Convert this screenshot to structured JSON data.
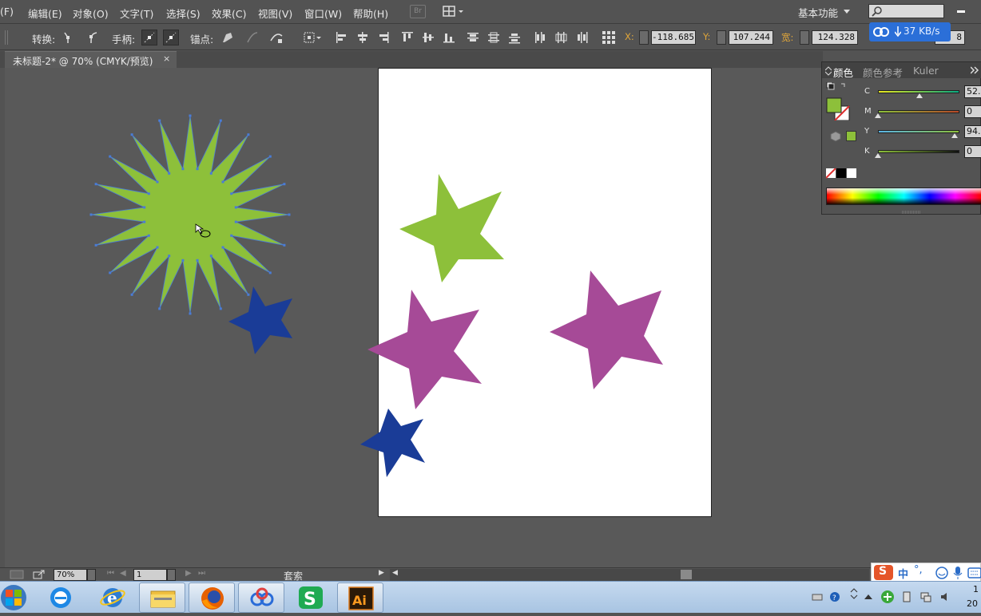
{
  "menubar": {
    "items": [
      "(F)",
      "编辑(E)",
      "对象(O)",
      "文字(T)",
      "选择(S)",
      "效果(C)",
      "视图(V)",
      "窗口(W)",
      "帮助(H)"
    ],
    "bridge_label": "Br",
    "workspace_label": "基本功能"
  },
  "controlbar": {
    "convert_label": "转换:",
    "handles_label": "手柄:",
    "anchors_label": "锚点:",
    "x_label": "X:",
    "x_value": "-118.685",
    "y_label": "Y:",
    "y_value": "107.244",
    "w_label": "宽:",
    "w_value": "124.328",
    "h_value": "8"
  },
  "speed_badge": {
    "text": "37 KB/s"
  },
  "document": {
    "tab_title": "未标题-2* @ 70% (CMYK/预览)",
    "close_glyph": "×"
  },
  "color_panel": {
    "tabs": [
      "颜色",
      "颜色参考",
      "Kuler"
    ],
    "channels": [
      {
        "label": "C",
        "value": "52."
      },
      {
        "label": "M",
        "value": "0"
      },
      {
        "label": "Y",
        "value": "94."
      },
      {
        "label": "K",
        "value": "0"
      }
    ]
  },
  "statusbar": {
    "zoom": "70%",
    "artboard": "1",
    "tool_name": "套索"
  },
  "taskbar": {
    "clock_top": "1",
    "clock_bottom": "20",
    "ime_text": "中"
  },
  "colors": {
    "green": "#8dc03a",
    "purple": "#a64a97",
    "blue": "#1a3c97",
    "panel_bg": "#535353",
    "canvas_bg": "#595959",
    "accent": "#e0a63a"
  },
  "icons": [
    "direct-select-icon",
    "pen-icon",
    "spectrum-icon",
    "firefox-icon",
    "ie-icon",
    "explorer-icon",
    "illustrator-icon"
  ]
}
